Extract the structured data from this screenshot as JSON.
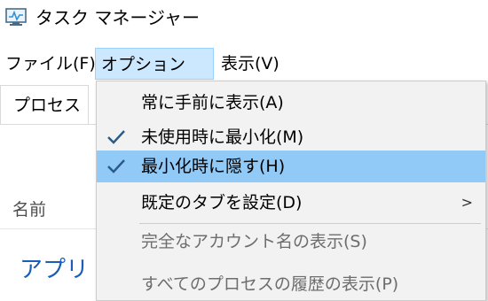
{
  "window": {
    "title": "タスク マネージャー"
  },
  "menubar": {
    "file": "ファイル(F)",
    "options": "オプション(O)",
    "view": "表示(V)"
  },
  "tabs": [
    {
      "label": "プロセス"
    }
  ],
  "table": {
    "column_name": "名前"
  },
  "group": {
    "label": "アプリ ("
  },
  "options_menu": {
    "items": [
      {
        "label": "常に手前に表示(A)",
        "checked": false,
        "enabled": true
      },
      {
        "label": "未使用時に最小化(M)",
        "checked": true,
        "enabled": true
      },
      {
        "label": "最小化時に隠す(H)",
        "checked": true,
        "enabled": true,
        "highlighted": true
      },
      {
        "label": "既定のタブを設定(D)",
        "checked": false,
        "enabled": true,
        "submenu_arrow": ">"
      },
      {
        "label": "完全なアカウント名の表示(S)",
        "checked": false,
        "enabled": false
      },
      {
        "label": "すべてのプロセスの履歴の表示(P)",
        "checked": false,
        "enabled": false
      }
    ]
  },
  "colors": {
    "menu_highlight": "#91c9f7",
    "menubar_active": "#cce8ff",
    "check": "#2b5b84",
    "group_text": "#1a5eb8",
    "disabled_text": "#6d6d6d"
  },
  "icons": [
    "task-manager-app-icon",
    "check-icon",
    "submenu-arrow-icon"
  ]
}
